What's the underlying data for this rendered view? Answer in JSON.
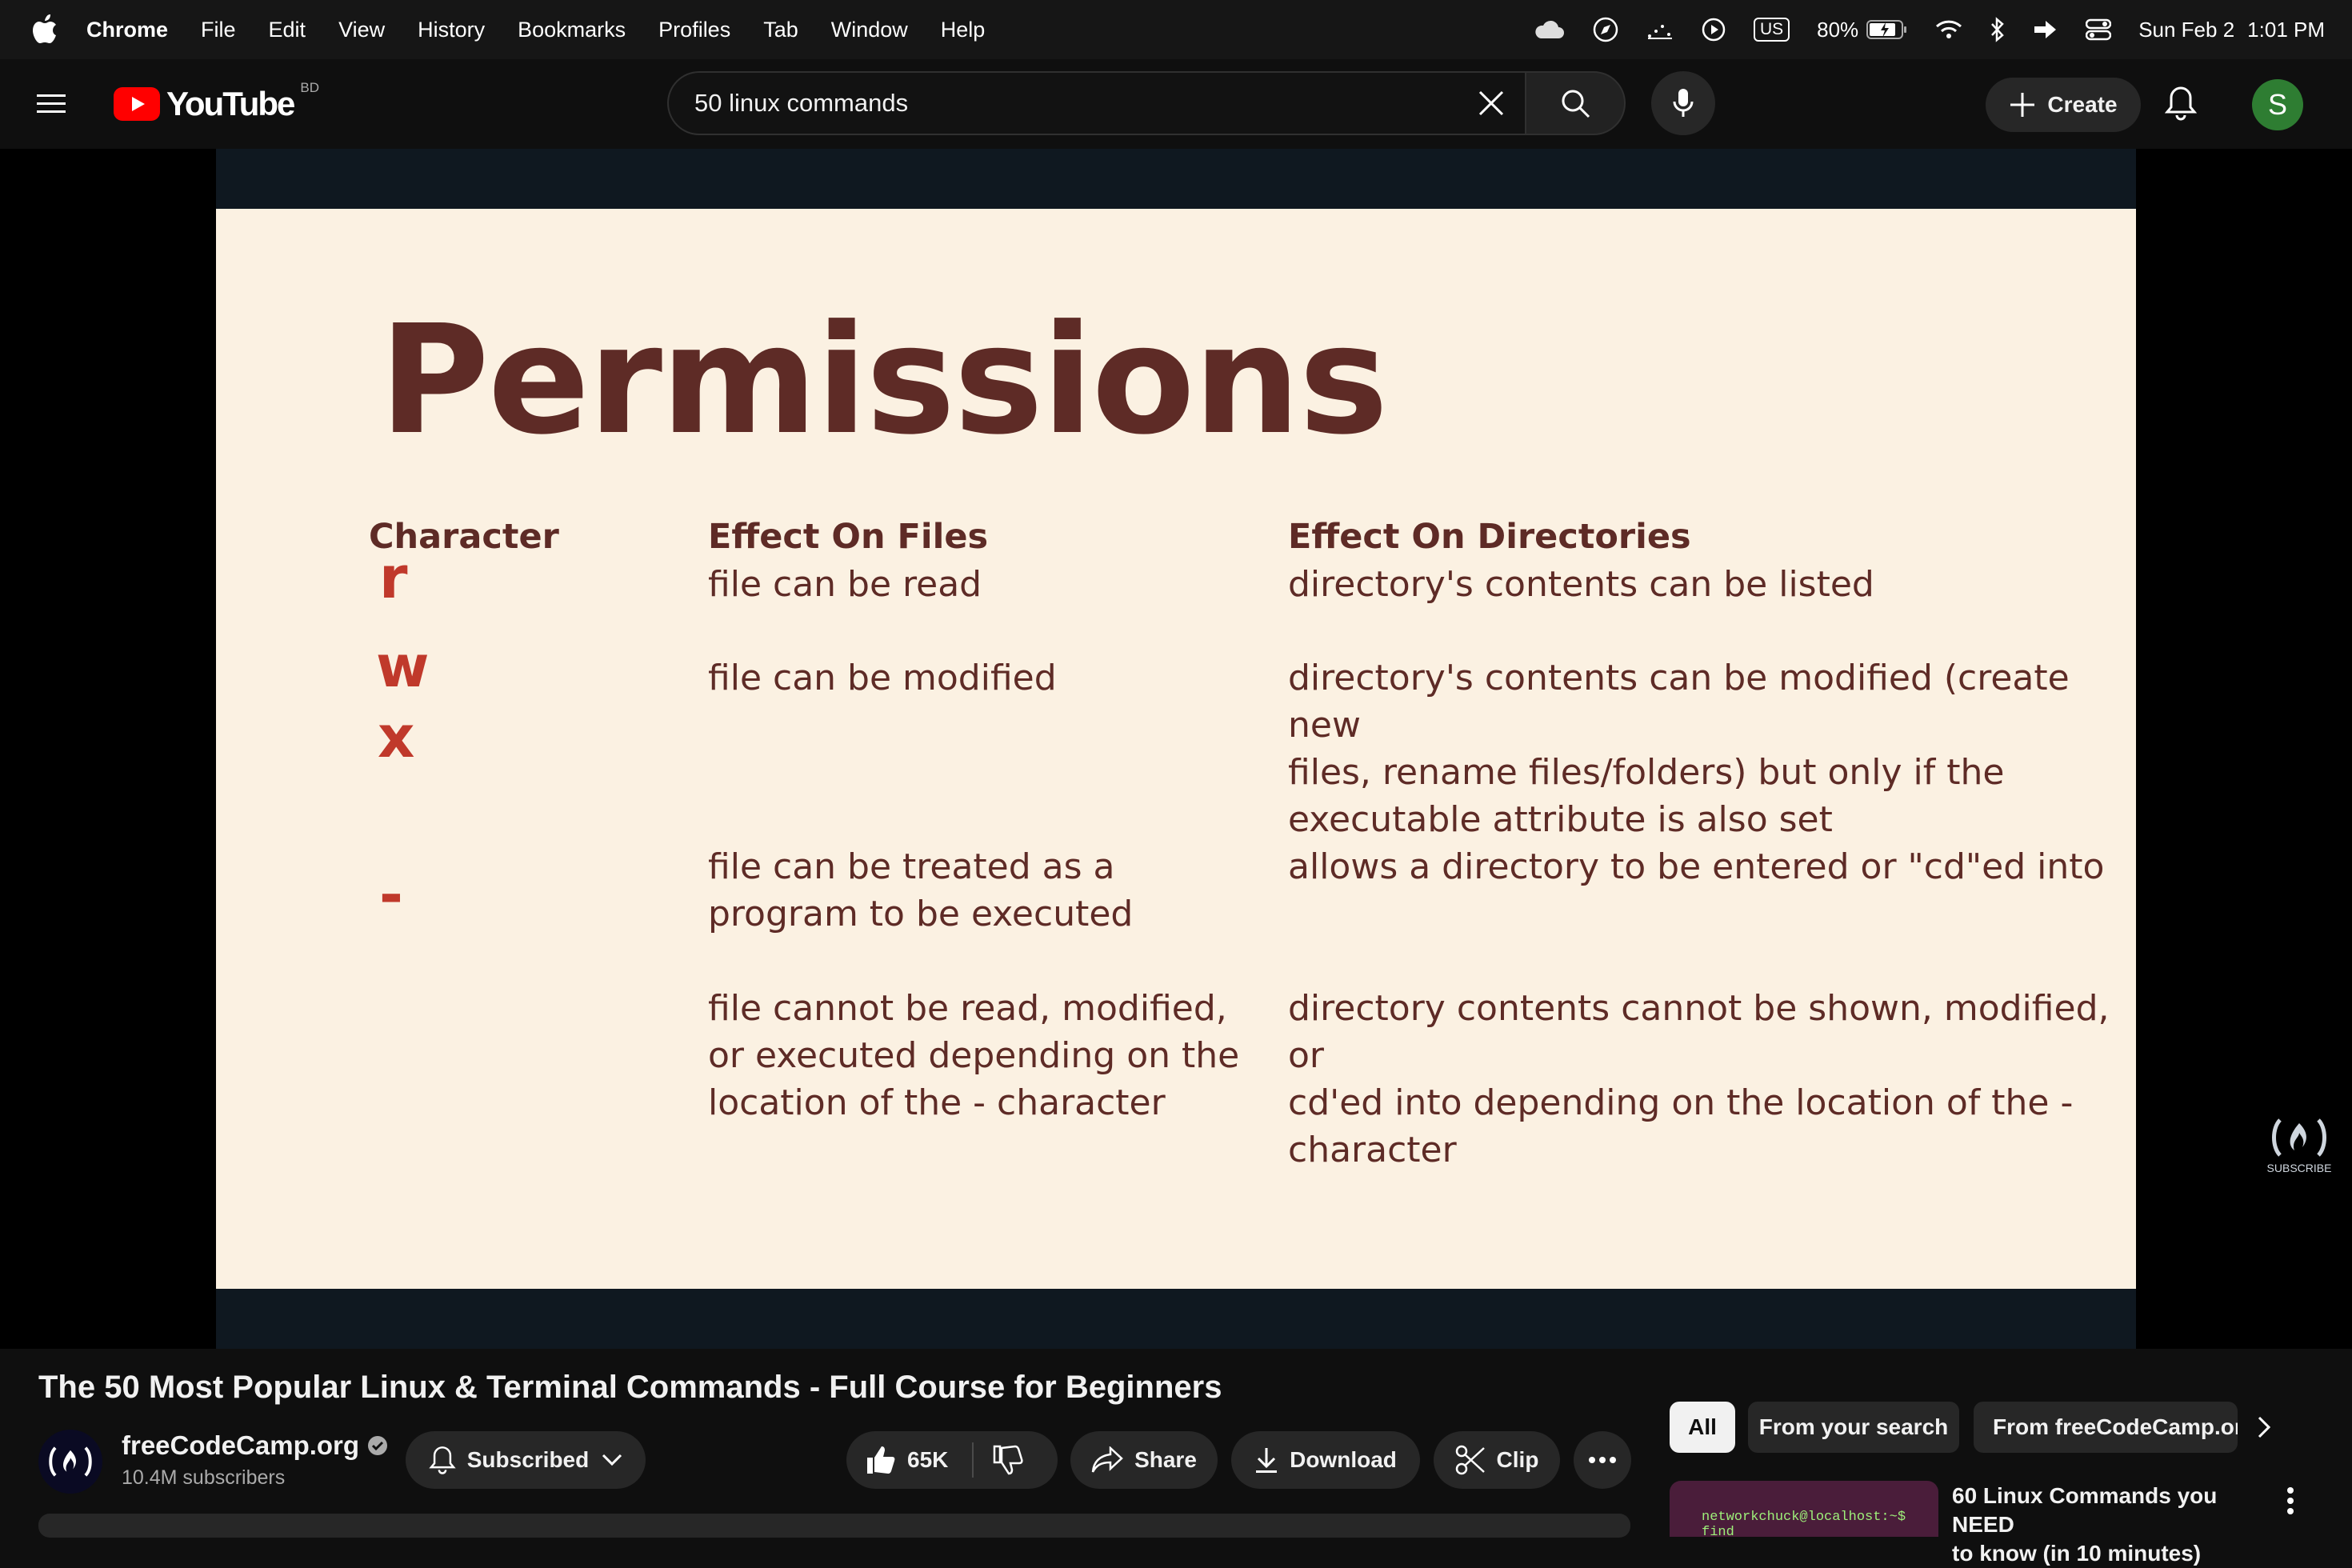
{
  "menubar": {
    "app": "Chrome",
    "items": [
      "File",
      "Edit",
      "View",
      "History",
      "Bookmarks",
      "Profiles",
      "Tab",
      "Window",
      "Help"
    ],
    "input_source": "US",
    "battery": "80%",
    "date": "Sun Feb 2",
    "time": "1:01 PM"
  },
  "header": {
    "logo_text": "YouTube",
    "country_code": "BD",
    "search_query": "50 linux commands",
    "create_label": "Create",
    "avatar_letter": "S",
    "accent": "#ff0000"
  },
  "slide": {
    "title": "Permissions",
    "headers": {
      "character": "Character",
      "files": "Effect On Files",
      "dirs": "Effect On Directories"
    },
    "rows": [
      {
        "char": "r",
        "files": [
          "file can be read"
        ],
        "dirs": [
          "directory's contents can be listed"
        ]
      },
      {
        "char": "w",
        "files": [
          "file can be modified"
        ],
        "dirs": [
          "directory's contents can be modified (create new",
          "files, rename files/folders) but only if the",
          "executable attribute is also set"
        ]
      },
      {
        "char": "x",
        "files": [
          "file can be treated as a",
          "program to be executed"
        ],
        "dirs": [
          "allows a directory to be entered or \"cd\"ed into"
        ]
      },
      {
        "char": "-",
        "files": [
          "file cannot be read, modified,",
          "or executed depending on the",
          "location of the - character"
        ],
        "dirs": [
          "directory contents cannot be shown, modified, or",
          "cd'ed into depending on the location of the -",
          "character"
        ]
      }
    ],
    "watermark": "SUBSCRIBE",
    "colors": {
      "background": "#fbf1e2",
      "text": "#5e2b26",
      "accent": "#c0392b"
    }
  },
  "video": {
    "title": "The 50 Most Popular Linux & Terminal Commands - Full Course for Beginners",
    "channel": "freeCodeCamp.org",
    "subscribers": "10.4M subscribers",
    "subscribed_label": "Subscribed",
    "likes": "65K",
    "share_label": "Share",
    "download_label": "Download",
    "clip_label": "Clip"
  },
  "sidebar": {
    "chips": [
      "All",
      "From your search",
      "From freeCodeCamp.org"
    ],
    "rec_title_lines": [
      "60 Linux Commands you NEED",
      "to know (in 10 minutes)"
    ],
    "rec_thumb_text": "networkchuck@localhost:~$ find"
  }
}
